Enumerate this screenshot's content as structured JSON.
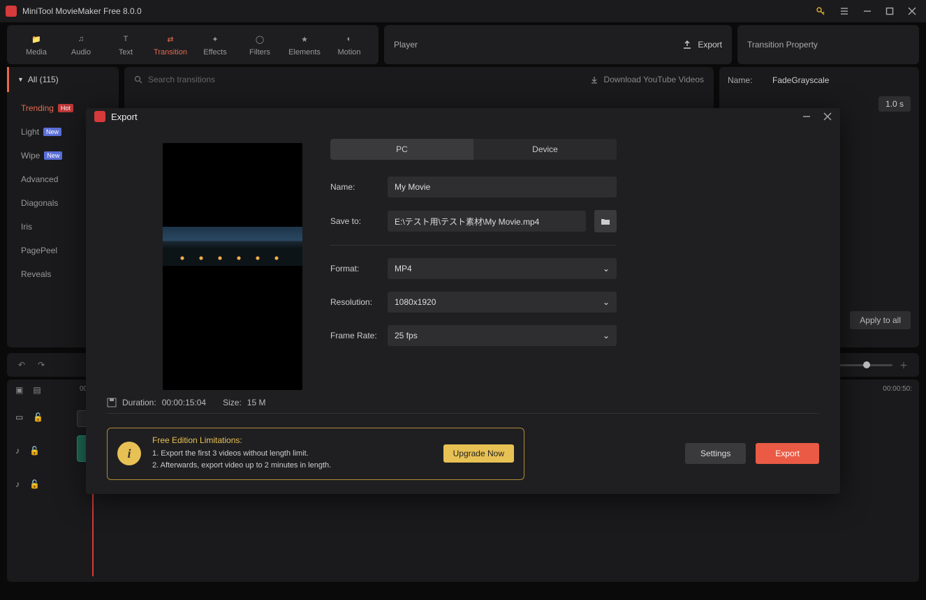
{
  "app": {
    "title": "MiniTool MovieMaker Free 8.0.0"
  },
  "toolbar": {
    "tabs": [
      "Media",
      "Audio",
      "Text",
      "Transition",
      "Effects",
      "Filters",
      "Elements",
      "Motion"
    ],
    "active": "Transition",
    "player_label": "Player",
    "export_label": "Export",
    "property_label": "Transition Property"
  },
  "categories": {
    "header": "All (115)",
    "active": "Trending",
    "items": [
      {
        "label": "Trending",
        "tag": "Hot"
      },
      {
        "label": "Light",
        "tag": "New"
      },
      {
        "label": "Wipe",
        "tag": "New"
      },
      {
        "label": "Advanced",
        "tag": null
      },
      {
        "label": "Diagonals",
        "tag": null
      },
      {
        "label": "Iris",
        "tag": null
      },
      {
        "label": "PagePeel",
        "tag": null
      },
      {
        "label": "Reveals",
        "tag": null
      }
    ]
  },
  "search": {
    "placeholder": "Search transitions",
    "download_label": "Download YouTube Videos"
  },
  "property": {
    "name_label": "Name:",
    "name_value": "FadeGrayscale",
    "duration_value": "1.0 s",
    "apply_all": "Apply to all"
  },
  "timeline": {
    "t_left": "00:",
    "t_right": "00:00:50:"
  },
  "export_modal": {
    "title": "Export",
    "tabs": {
      "pc": "PC",
      "device": "Device",
      "active": "PC"
    },
    "name_label": "Name:",
    "name_value": "My Movie",
    "save_label": "Save to:",
    "save_value": "E:\\テスト用\\テスト素材\\My Movie.mp4",
    "format_label": "Format:",
    "format_value": "MP4",
    "resolution_label": "Resolution:",
    "resolution_value": "1080x1920",
    "framerate_label": "Frame Rate:",
    "framerate_value": "25 fps",
    "info_duration_label": "Duration:",
    "info_duration_value": "00:00:15:04",
    "info_size_label": "Size:",
    "info_size_value": "15 M",
    "limitations": {
      "heading": "Free Edition Limitations:",
      "line1": "1. Export the first 3 videos without length limit.",
      "line2": "2. Afterwards, export video up to 2 minutes in length.",
      "upgrade": "Upgrade Now"
    },
    "settings_label": "Settings",
    "export_label": "Export"
  }
}
